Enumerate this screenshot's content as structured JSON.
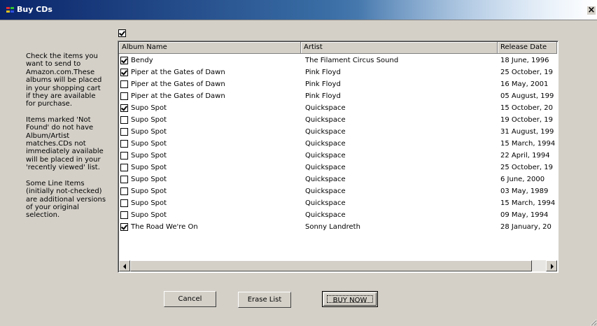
{
  "window": {
    "title": "Buy CDs",
    "close_label": "×"
  },
  "instructions": [
    "Check the items you want to send to Amazon.com.These albums will be placed in your shopping cart if they are available for purchase.",
    "Items marked 'Not Found'  do not have Album/Artist matches.CDs not immediately available will be placed in your 'recently viewed' list.",
    "Some Line Items (initially not-checked) are additional versions of your original selection."
  ],
  "select_all_checked": true,
  "columns": {
    "album": "Album Name",
    "artist": "Artist",
    "release": "Release Date"
  },
  "rows": [
    {
      "checked": true,
      "album": "Bendy",
      "artist": "The Filament Circus Sound",
      "release": "18 June, 1996"
    },
    {
      "checked": true,
      "album": "Piper at the Gates of Dawn",
      "artist": "Pink Floyd",
      "release": "25 October, 19"
    },
    {
      "checked": false,
      "album": "Piper at the Gates of Dawn",
      "artist": "Pink Floyd",
      "release": "16 May, 2001"
    },
    {
      "checked": false,
      "album": "Piper at the Gates of Dawn",
      "artist": "Pink Floyd",
      "release": "05 August, 199"
    },
    {
      "checked": true,
      "album": "Supo Spot",
      "artist": "Quickspace",
      "release": "15 October, 20"
    },
    {
      "checked": false,
      "album": "Supo Spot",
      "artist": "Quickspace",
      "release": "19 October, 19"
    },
    {
      "checked": false,
      "album": "Supo Spot",
      "artist": "Quickspace",
      "release": "31 August, 199"
    },
    {
      "checked": false,
      "album": "Supo Spot",
      "artist": "Quickspace",
      "release": "15 March, 1994"
    },
    {
      "checked": false,
      "album": "Supo Spot",
      "artist": "Quickspace",
      "release": "22 April, 1994"
    },
    {
      "checked": false,
      "album": "Supo Spot",
      "artist": "Quickspace",
      "release": "25 October, 19"
    },
    {
      "checked": false,
      "album": "Supo Spot",
      "artist": "Quickspace",
      "release": "6 June, 2000"
    },
    {
      "checked": false,
      "album": "Supo Spot",
      "artist": "Quickspace",
      "release": "03 May, 1989"
    },
    {
      "checked": false,
      "album": "Supo Spot",
      "artist": "Quickspace",
      "release": "15 March, 1994"
    },
    {
      "checked": false,
      "album": "Supo Spot",
      "artist": "Quickspace",
      "release": "09 May, 1994"
    },
    {
      "checked": true,
      "album": "The Road We're On",
      "artist": "Sonny Landreth",
      "release": "28 January, 20"
    }
  ],
  "buttons": {
    "cancel": "Cancel",
    "erase": "Erase List",
    "buy": "BUY NOW"
  }
}
